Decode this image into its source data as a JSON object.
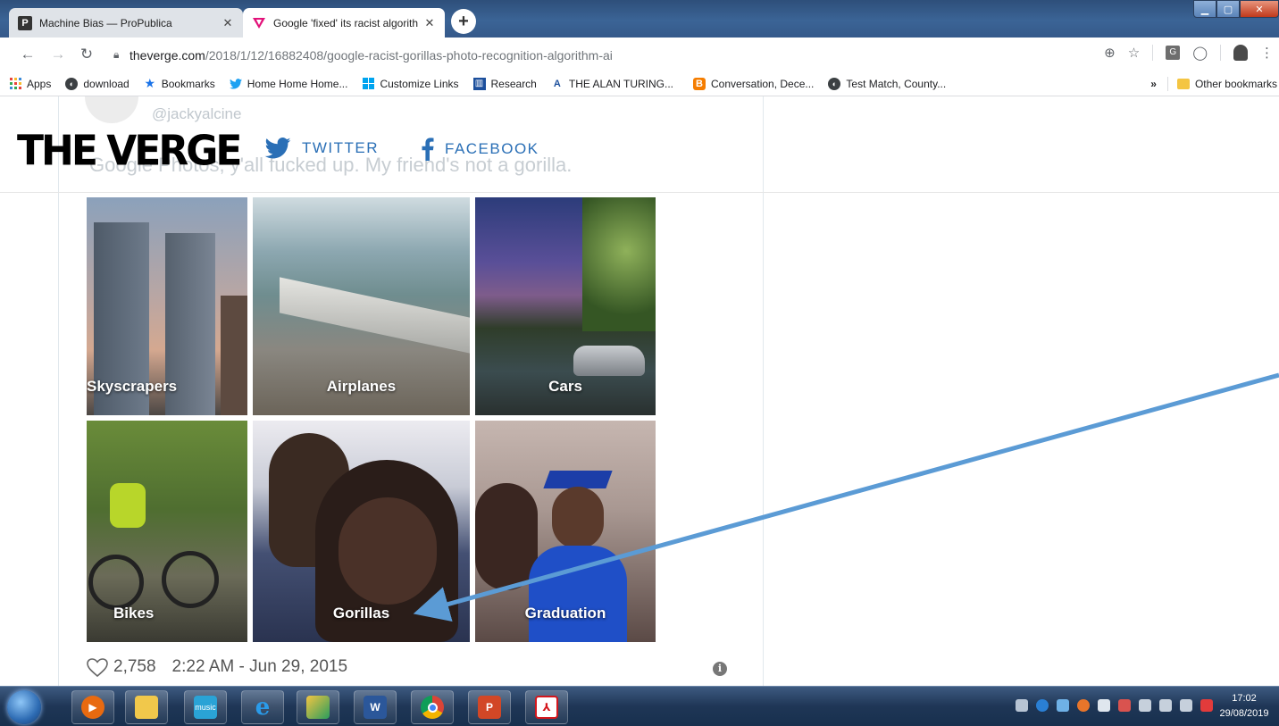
{
  "tabs": [
    {
      "title": "Machine Bias — ProPublica",
      "favicon": "propublica-favicon",
      "active": false
    },
    {
      "title": "Google 'fixed' its racist algorithm",
      "favicon": "verge-favicon",
      "active": true
    }
  ],
  "address": {
    "host": "theverge.com",
    "path": "/2018/1/12/16882408/google-racist-gorillas-photo-recognition-algorithm-ai"
  },
  "bookmarks": [
    {
      "label": "Apps",
      "icon": "apps-grid-icon"
    },
    {
      "label": "download",
      "icon": "globe-icon"
    },
    {
      "label": "Bookmarks",
      "icon": "star-icon"
    },
    {
      "label": "Home Home Home...",
      "icon": "twitter-icon"
    },
    {
      "label": "Customize Links",
      "icon": "windows-icon"
    },
    {
      "label": "Research",
      "icon": "library-icon"
    },
    {
      "label": "THE ALAN TURING...",
      "icon": "turing-icon"
    },
    {
      "label": "Conversation, Dece...",
      "icon": "blogger-icon"
    },
    {
      "label": "Test Match, County...",
      "icon": "globe-icon"
    }
  ],
  "bookmarks_overflow": "»",
  "other_bookmarks": "Other bookmarks",
  "verge": {
    "logo": "THE VERGE",
    "twitter": "TWITTER",
    "facebook": "FACEBOOK"
  },
  "tweet": {
    "handle": "@jackyalcine",
    "text": "Google Photos, y'all fucked up. My friend's not a gorilla.",
    "likes": "2,758",
    "timestamp": "2:22 AM - Jun 29, 2015"
  },
  "photos": [
    {
      "label": "Skyscrapers"
    },
    {
      "label": "Airplanes"
    },
    {
      "label": "Cars"
    },
    {
      "label": "Bikes"
    },
    {
      "label": "Gorillas"
    },
    {
      "label": "Graduation"
    }
  ],
  "taskbar": {
    "music_label": "music",
    "clock_time": "17:02",
    "clock_date": "29/08/2019"
  },
  "colors": {
    "verge_link": "#2a6fb6",
    "arrow": "#5b9bd5"
  }
}
